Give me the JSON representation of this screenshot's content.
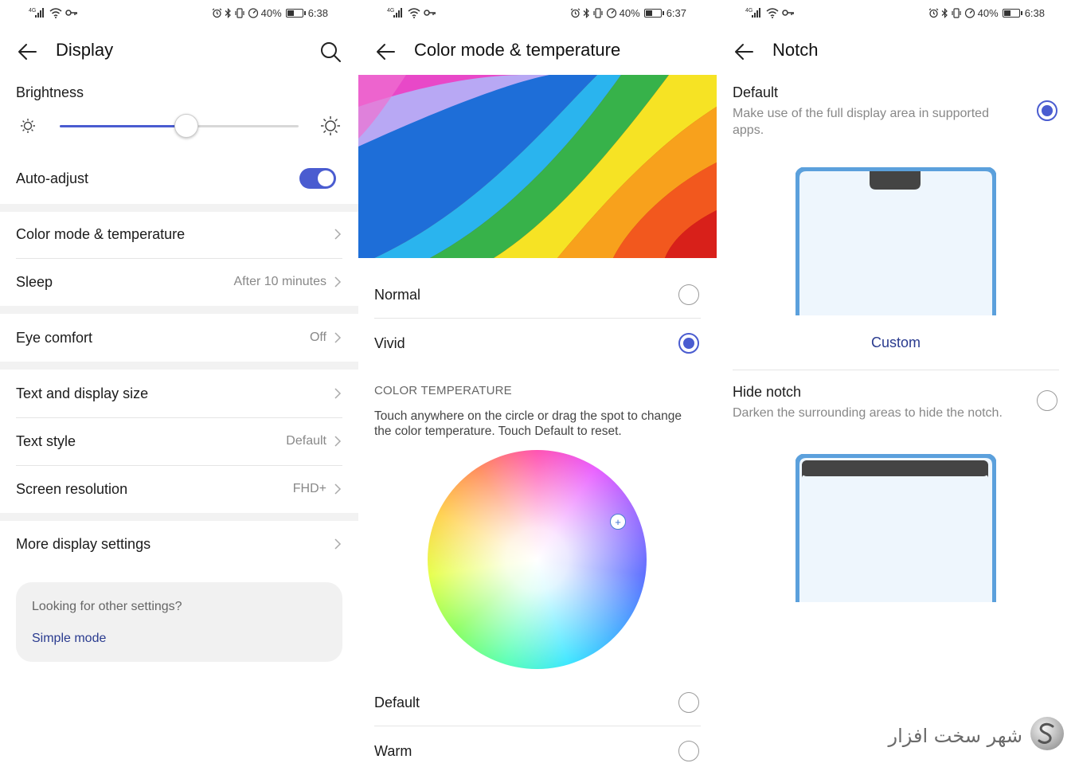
{
  "status_bars": [
    {
      "network": "4G",
      "battery": "40%",
      "time": "6:38"
    },
    {
      "network": "4G",
      "battery": "40%",
      "time": "6:37"
    },
    {
      "network": "4G",
      "battery": "40%",
      "time": "6:38"
    }
  ],
  "display": {
    "title": "Display",
    "brightness_label": "Brightness",
    "brightness_level": 0.53,
    "auto_adjust_label": "Auto-adjust",
    "auto_adjust_on": true,
    "items": [
      {
        "label": "Color mode & temperature",
        "value": ""
      },
      {
        "label": "Sleep",
        "value": "After 10 minutes"
      },
      {
        "label": "Eye comfort",
        "value": "Off"
      },
      {
        "label": "Text and display size",
        "value": ""
      },
      {
        "label": "Text style",
        "value": "Default"
      },
      {
        "label": "Screen resolution",
        "value": "FHD+"
      },
      {
        "label": "More display settings",
        "value": ""
      }
    ],
    "card": {
      "question": "Looking for other settings?",
      "link": "Simple mode"
    }
  },
  "color_mode": {
    "title": "Color mode & temperature",
    "modes": [
      {
        "label": "Normal",
        "selected": false
      },
      {
        "label": "Vivid",
        "selected": true
      }
    ],
    "section_title": "COLOR TEMPERATURE",
    "section_desc": "Touch anywhere on the circle or drag the spot to change the color temperature. Touch Default to reset.",
    "temps": [
      {
        "label": "Default",
        "selected": false
      },
      {
        "label": "Warm",
        "selected": false
      }
    ]
  },
  "notch": {
    "title": "Notch",
    "default_title": "Default",
    "default_desc": "Make use of the full display area in supported apps.",
    "default_selected": true,
    "custom_label": "Custom",
    "hide_title": "Hide notch",
    "hide_desc": "Darken the surrounding areas to hide the notch.",
    "hide_selected": false
  },
  "watermark_text": "شهر سخت افزار",
  "colors": {
    "accent": "#4a5cd0",
    "link": "#2a3b8f",
    "phone_frame": "#5ba0dc",
    "notch": "#444444"
  }
}
